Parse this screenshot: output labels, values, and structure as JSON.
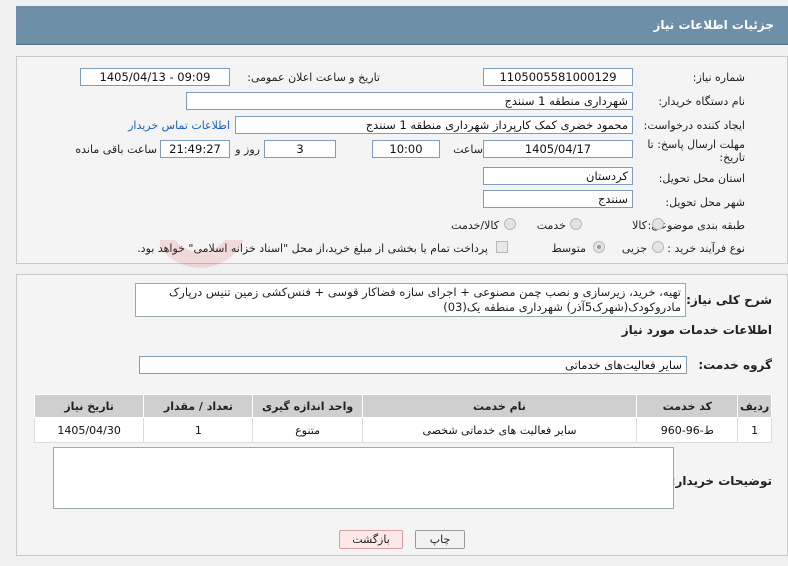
{
  "header": {
    "title": "جزئیات اطلاعات نیاز"
  },
  "form": {
    "need_number_label": "شماره نیاز:",
    "need_number": "1105005581000129",
    "announce_label": "تاریخ و ساعت اعلان عمومی:",
    "announce_value": "1405/04/13 - 09:09",
    "buyer_org_label": "نام دستگاه خریدار:",
    "buyer_org": "شهرداری منطقه 1 سنندج",
    "creator_label": "ایجاد کننده درخواست:",
    "creator": "محمود خضری کمک کارپرداز شهرداری منطقه 1 سنندج",
    "contact_link": "اطلاعات تماس خریدار",
    "deadline_label": "مهلت ارسال پاسخ: تا تاریخ:",
    "deadline_date": "1405/04/17",
    "time_label": "ساعت",
    "deadline_time": "10:00",
    "days_value": "3",
    "days_label": "روز و",
    "remaining_time": "21:49:27",
    "remaining_label": "ساعت باقی مانده",
    "province_label": "استان محل تحویل:",
    "province": "کردستان",
    "city_label": "شهر محل تحویل:",
    "city": "سنندج",
    "category_label": "طبقه بندی موضوعی:",
    "category_options": [
      "کالا",
      "خدمت",
      "کالا/خدمت"
    ],
    "process_label": "نوع فرآیند خرید :",
    "process_options": [
      "جزیی",
      "متوسط"
    ],
    "payment_note": "پرداخت تمام یا بخشی از مبلغ خرید،از محل \"اسناد خزانه اسلامی\" خواهد بود."
  },
  "summary": {
    "label": "شرح کلی نیاز:",
    "text": "تهیه، خرید، زیرسازی و نصب چمن مصنوعی + اجرای سازه فضاکار قوسی + فنس‌کشی زمین تنیس درپارک مادروکودک(شهرک5آذر) شهرداری منطقه یک(03)"
  },
  "services_title": "اطلاعات خدمات مورد نیاز",
  "service_group": {
    "label": "گروه خدمت:",
    "value": "سایر فعالیت‌های خدماتی"
  },
  "table": {
    "headers": [
      "ردیف",
      "کد خدمت",
      "نام خدمت",
      "واحد اندازه گیری",
      "تعداد / مقدار",
      "تاریخ نیاز"
    ],
    "rows": [
      [
        "1",
        "ط-96-960",
        "سایر فعالیت های خدماتی شخصی",
        "متنوع",
        "1",
        "1405/04/30"
      ]
    ]
  },
  "buyer_notes": {
    "label": "توضیحات خریدار:",
    "value": ""
  },
  "buttons": {
    "print": "چاپ",
    "back": "بازگشت"
  }
}
